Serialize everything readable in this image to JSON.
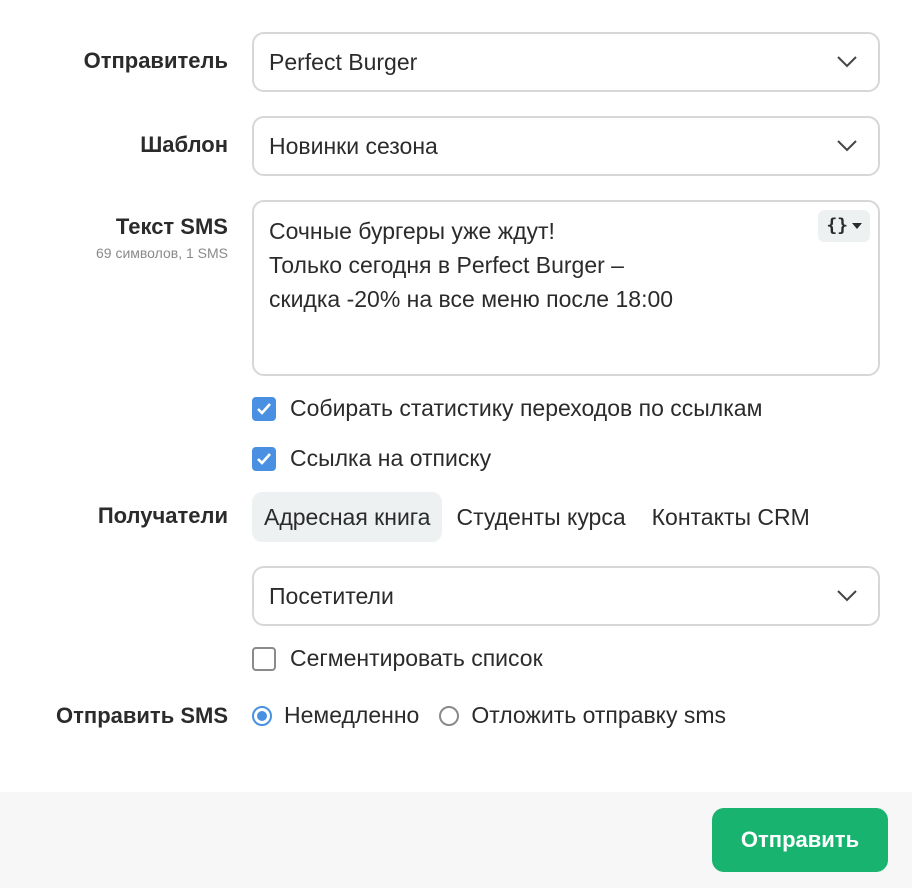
{
  "sender": {
    "label": "Отправитель",
    "value": "Perfect Burger"
  },
  "template": {
    "label": "Шаблон",
    "value": "Новинки сезона"
  },
  "sms_text": {
    "label": "Текст SMS",
    "counter": "69 символов, 1 SMS",
    "lines": [
      "Сочные бургеры уже ждут!",
      "Только сегодня в Perfect Burger –",
      "скидка -20% на все меню после 18:00"
    ],
    "variables_button": "{}"
  },
  "options": {
    "track_clicks": {
      "label": "Собирать статистику переходов по ссылкам",
      "checked": true
    },
    "unsubscribe_link": {
      "label": "Ссылка на отписку",
      "checked": true
    }
  },
  "recipients": {
    "label": "Получатели",
    "tabs": [
      {
        "label": "Адресная книга",
        "active": true
      },
      {
        "label": "Студенты курса",
        "active": false
      },
      {
        "label": "Контакты CRM",
        "active": false
      }
    ],
    "list_value": "Посетители",
    "segment": {
      "label": "Сегментировать список",
      "checked": false
    }
  },
  "send_time": {
    "label": "Отправить SMS",
    "options": [
      {
        "label": "Немедленно",
        "selected": true
      },
      {
        "label": "Отложить отправку sms",
        "selected": false
      }
    ]
  },
  "submit_label": "Отправить",
  "colors": {
    "accent": "#4a90e2",
    "submit": "#18b36e"
  }
}
